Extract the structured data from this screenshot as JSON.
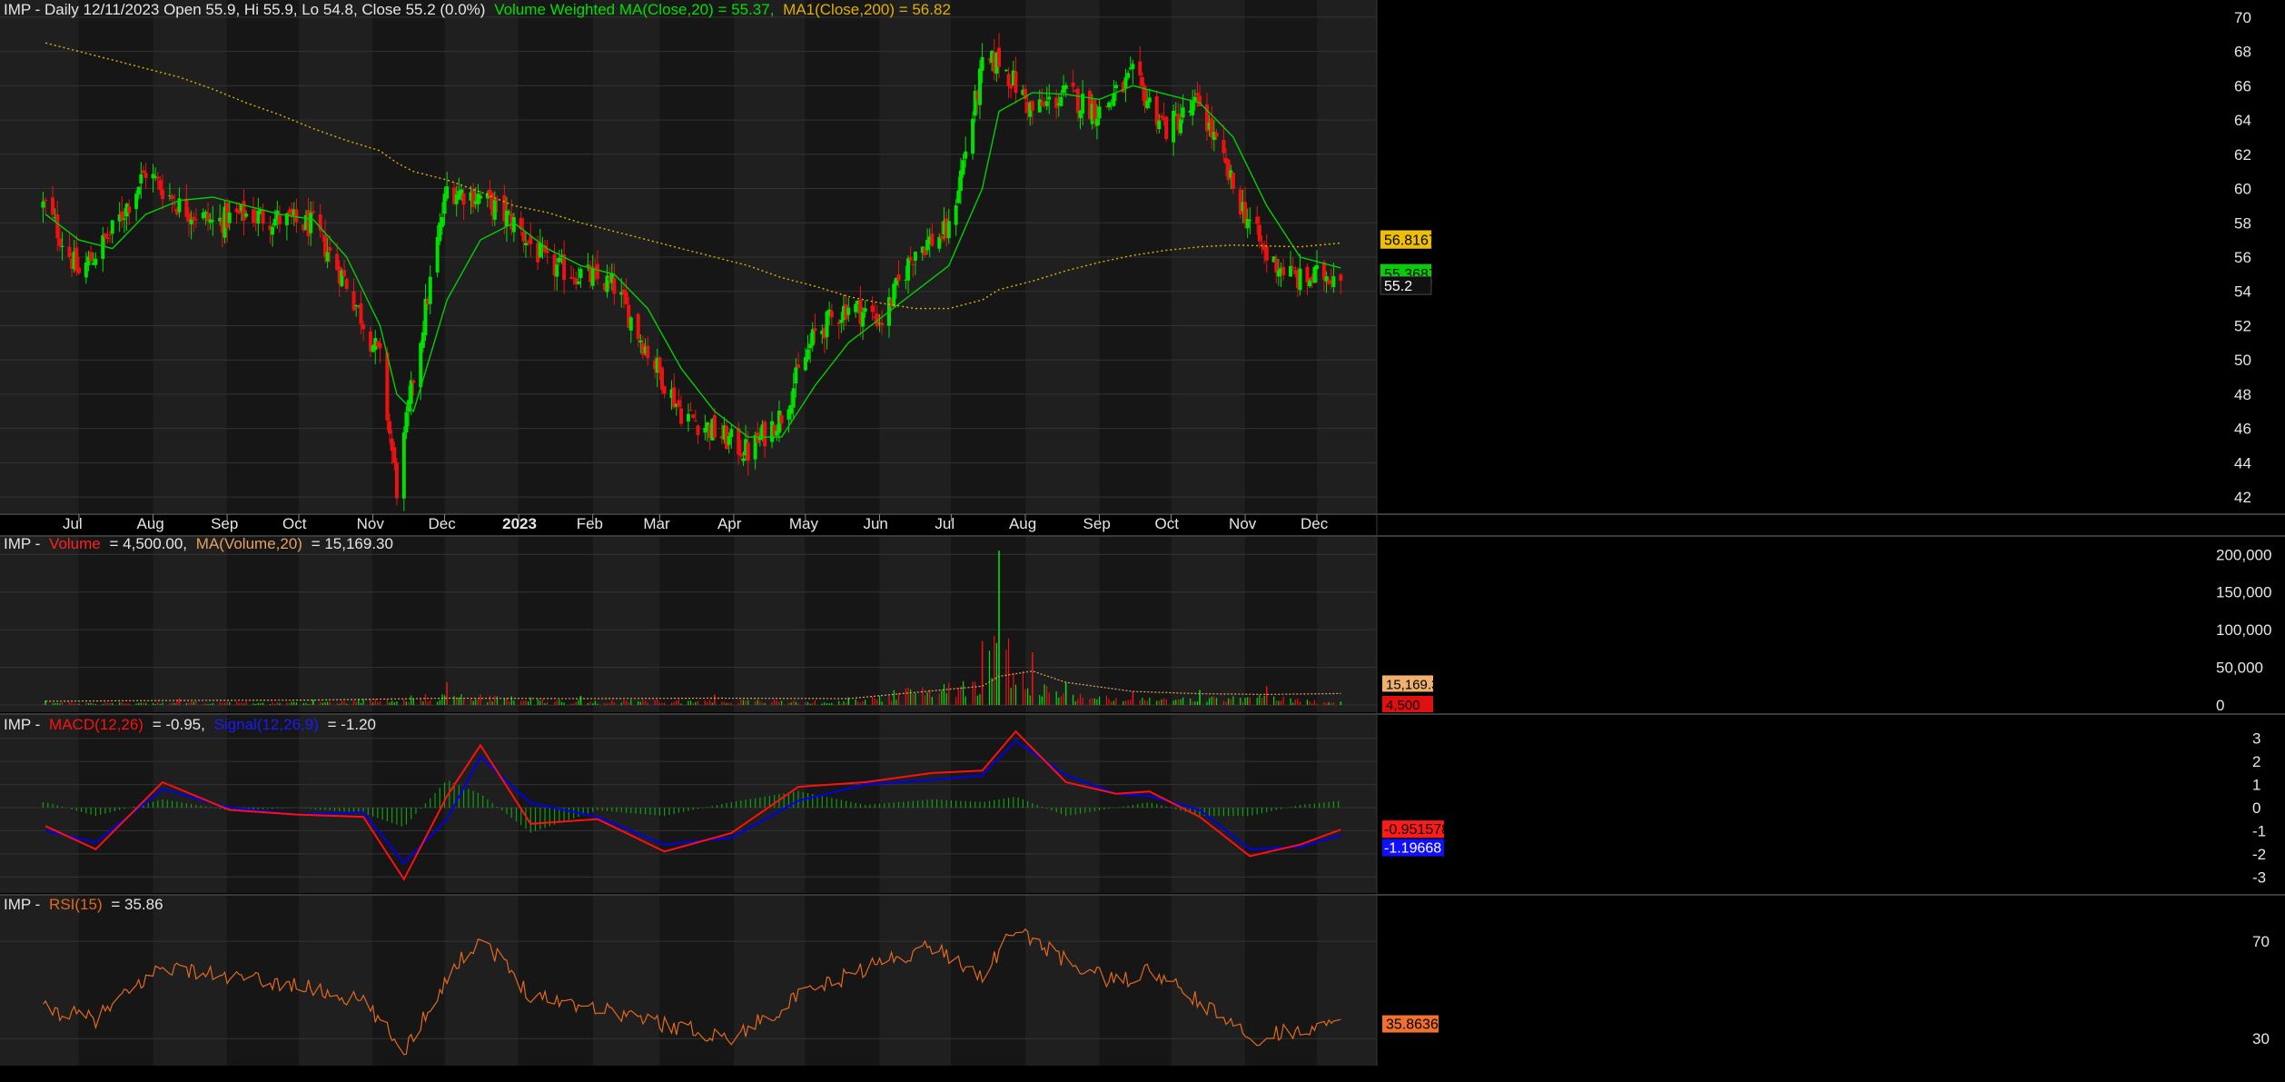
{
  "colors": {
    "background": "#000000",
    "panel_light": "#1f1f1f",
    "panel_dark": "#161616",
    "grid": "#333333",
    "text": "#e6e6e6",
    "up_candle": "#00e000",
    "down_candle": "#ee1111",
    "vwma": "#00d000",
    "ma200": "#e0b000",
    "volume_ma": "#e6a060",
    "macd": "#ff1010",
    "signal": "#0000ee",
    "histogram": "#10a010",
    "rsi": "#e2691e"
  },
  "price_panel": {
    "title_prefix": "IMP - Daily 12/11/2023 Open 55.9, Hi 55.9, Lo 54.8, Close 55.2 (0.0%)",
    "vwma_label": "Volume Weighted MA(Close,20) = 55.37,",
    "ma_label": "MA1(Close,200) = 56.82"
  },
  "volume_panel": {
    "title_prefix": "IMP -",
    "volume_label": "Volume",
    "volume_value": "= 4,500.00,",
    "ma_label": "MA(Volume,20)",
    "ma_value": "= 15,169.30"
  },
  "macd_panel": {
    "title_prefix": "IMP -",
    "macd_label": "MACD(12,26)",
    "macd_value": "= -0.95,",
    "signal_label": "Signal(12,26,9)",
    "signal_value": "= -1.20"
  },
  "rsi_panel": {
    "title_prefix": "IMP -",
    "rsi_label": "RSI(15)",
    "rsi_value": "= 35.86"
  },
  "price_axis": {
    "ticks": [
      "70",
      "68",
      "66",
      "64",
      "62",
      "60",
      "58",
      "56",
      "54",
      "52",
      "50",
      "48",
      "46",
      "44",
      "42"
    ],
    "badges": [
      "56.8167",
      "55.3687",
      "55.2"
    ]
  },
  "volume_axis": {
    "ticks": [
      "200,000",
      "150,000",
      "100,000",
      "50,000",
      "0"
    ],
    "badges": [
      "15,169.3",
      "4,500"
    ]
  },
  "macd_axis": {
    "ticks": [
      "3",
      "2",
      "1",
      "0",
      "-1",
      "-2",
      "-3"
    ],
    "badges": [
      "-0.951578",
      "-1.19668"
    ]
  },
  "rsi_axis": {
    "ticks": [
      "70",
      "30"
    ],
    "badges": [
      "35.8636"
    ]
  },
  "time_axis": {
    "labels": [
      "Jul",
      "Aug",
      "Sep",
      "Oct",
      "Nov",
      "Dec",
      "2023",
      "Feb",
      "Mar",
      "Apr",
      "May",
      "Jun",
      "Jul",
      "Aug",
      "Sep",
      "Oct",
      "Nov",
      "Dec"
    ]
  },
  "chart_data": [
    {
      "type": "candlestick",
      "title": "IMP - Daily 12/11/2023 Open 55.9, Hi 55.9, Lo 54.8, Close 55.2 (0.0%)",
      "ylim": [
        41,
        71
      ],
      "x": [
        "2022-06-17",
        "2022-07-01",
        "2022-07-15",
        "2022-07-29",
        "2022-08-12",
        "2022-08-26",
        "2022-09-09",
        "2022-09-23",
        "2022-10-07",
        "2022-10-21",
        "2022-11-04",
        "2022-11-11",
        "2022-11-18",
        "2022-12-02",
        "2022-12-16",
        "2022-12-30",
        "2023-01-13",
        "2023-01-27",
        "2023-02-10",
        "2023-02-24",
        "2023-03-10",
        "2023-03-24",
        "2023-04-07",
        "2023-04-21",
        "2023-05-05",
        "2023-05-19",
        "2023-06-02",
        "2023-06-16",
        "2023-06-30",
        "2023-07-14",
        "2023-07-21",
        "2023-08-04",
        "2023-08-18",
        "2023-09-01",
        "2023-09-15",
        "2023-09-29",
        "2023-10-13",
        "2023-10-27",
        "2023-11-10",
        "2023-11-24",
        "2023-12-11"
      ],
      "series": [
        {
          "name": "Close",
          "values": [
            59,
            55,
            57.5,
            61,
            59,
            58,
            58.5,
            58.2,
            57.8,
            54.5,
            50,
            42.5,
            49,
            60,
            59.5,
            58,
            55.5,
            55,
            54.3,
            50.5,
            47,
            45.8,
            44.6,
            46.8,
            51.5,
            53.2,
            52.3,
            56.5,
            57.5,
            67,
            67.5,
            64.5,
            65.5,
            64.5,
            66.5,
            63.5,
            65,
            60,
            56,
            54.6,
            55.2
          ]
        },
        {
          "name": "Volume Weighted MA(Close,20)",
          "values": [
            58.5,
            57,
            56.5,
            58.5,
            59.3,
            59.5,
            59,
            58.5,
            58.2,
            56,
            52,
            48,
            47,
            53.5,
            57,
            58,
            56.5,
            55.5,
            55,
            53,
            49.5,
            47,
            45.5,
            45.5,
            48.5,
            51,
            52.5,
            54,
            55.5,
            60,
            64.5,
            65.6,
            65.5,
            65.2,
            66,
            65.5,
            65,
            63,
            59,
            56,
            55.37
          ]
        },
        {
          "name": "MA1(Close,200)",
          "values": [
            68.5,
            68,
            67.5,
            67,
            66.5,
            65.8,
            65,
            64.3,
            63.5,
            62.8,
            62.2,
            61.5,
            61,
            60.5,
            59.8,
            59,
            58.6,
            58,
            57.5,
            57,
            56.5,
            56,
            55.5,
            54.8,
            54.3,
            53.7,
            53.3,
            53,
            53,
            53.5,
            54.1,
            54.6,
            55.2,
            55.7,
            56.1,
            56.4,
            56.6,
            56.7,
            56.65,
            56.6,
            56.82
          ]
        }
      ]
    },
    {
      "type": "bar",
      "title": "Volume",
      "ylim": [
        0,
        210000
      ],
      "x": [
        "2022-06-17",
        "2022-08-12",
        "2022-10-07",
        "2022-12-02",
        "2023-01-27",
        "2023-03-24",
        "2023-05-19",
        "2023-07-14",
        "2023-07-21",
        "2023-08-04",
        "2023-08-18",
        "2023-09-15",
        "2023-10-13",
        "2023-11-10",
        "2023-12-11"
      ],
      "series": [
        {
          "name": "Volume",
          "values": [
            6000,
            9000,
            7000,
            30000,
            12000,
            14000,
            10000,
            85000,
            205000,
            70000,
            30000,
            18000,
            20000,
            25000,
            4500
          ]
        },
        {
          "name": "MA(Volume,20)",
          "values": [
            5000,
            6000,
            6500,
            9000,
            8500,
            9000,
            8500,
            25000,
            38000,
            45000,
            30000,
            18000,
            15000,
            14000,
            15169.3
          ]
        }
      ]
    },
    {
      "type": "line",
      "title": "MACD",
      "ylim": [
        -3.5,
        3.5
      ],
      "x": [
        "2022-06-17",
        "2022-07-08",
        "2022-08-05",
        "2022-09-02",
        "2022-09-30",
        "2022-10-28",
        "2022-11-14",
        "2022-12-02",
        "2022-12-16",
        "2023-01-06",
        "2023-02-03",
        "2023-03-03",
        "2023-03-31",
        "2023-04-28",
        "2023-05-26",
        "2023-06-23",
        "2023-07-14",
        "2023-07-28",
        "2023-08-18",
        "2023-09-08",
        "2023-09-22",
        "2023-10-13",
        "2023-11-03",
        "2023-11-24",
        "2023-12-11"
      ],
      "series": [
        {
          "name": "MACD(12,26)",
          "values": [
            -0.8,
            -1.8,
            1.1,
            -0.1,
            -0.3,
            -0.4,
            -3.1,
            0.5,
            2.7,
            -0.7,
            -0.5,
            -1.9,
            -1.1,
            0.9,
            1.1,
            1.5,
            1.6,
            3.3,
            1.1,
            0.6,
            0.7,
            -0.4,
            -2.1,
            -1.6,
            -0.95
          ]
        },
        {
          "name": "Signal(12,26,9)",
          "values": [
            -1,
            -1.5,
            0.8,
            0,
            -0.3,
            -0.2,
            -2.4,
            -0.5,
            2.2,
            0.2,
            -0.4,
            -1.6,
            -1.3,
            0.3,
            1,
            1.2,
            1.4,
            2.9,
            1.4,
            0.6,
            0.5,
            -0.1,
            -1.8,
            -1.7,
            -1.2
          ]
        }
      ]
    },
    {
      "type": "line",
      "title": "RSI(15)",
      "ylim": [
        20,
        85
      ],
      "x": [
        "2022-06-17",
        "2022-07-08",
        "2022-08-05",
        "2022-09-02",
        "2022-09-30",
        "2022-10-28",
        "2022-11-14",
        "2022-12-02",
        "2022-12-16",
        "2023-01-06",
        "2023-02-03",
        "2023-03-03",
        "2023-03-31",
        "2023-04-28",
        "2023-05-26",
        "2023-06-23",
        "2023-07-14",
        "2023-07-28",
        "2023-08-18",
        "2023-09-08",
        "2023-09-22",
        "2023-10-13",
        "2023-11-03",
        "2023-11-24",
        "2023-12-11"
      ],
      "series": [
        {
          "name": "RSI(15)",
          "values": [
            42,
            38,
            60,
            55,
            52,
            45,
            25,
            55,
            72,
            48,
            43,
            36,
            30,
            47,
            59,
            68,
            56,
            75,
            62,
            53,
            58,
            45,
            30,
            34,
            35.86
          ]
        }
      ]
    }
  ]
}
